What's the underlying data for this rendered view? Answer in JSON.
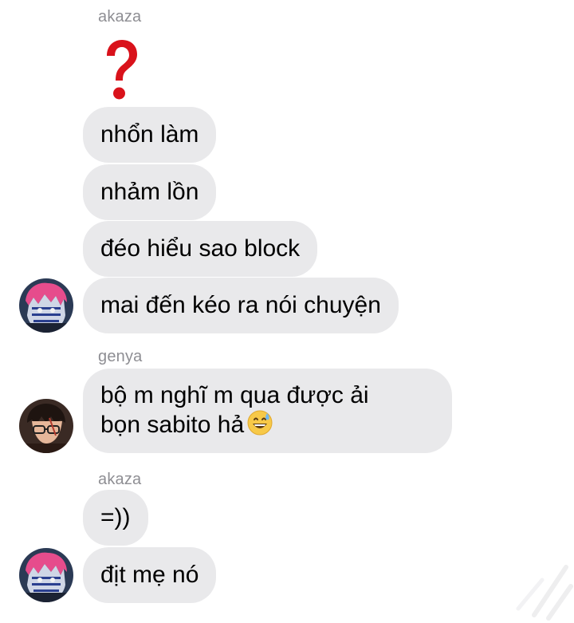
{
  "conversation": [
    {
      "sender": "akaza",
      "messages": [
        {
          "kind": "emoji",
          "icon": "red-question-mark-icon"
        },
        {
          "kind": "text",
          "text": "nhổn làm"
        },
        {
          "kind": "text",
          "text": "nhảm lồn"
        },
        {
          "kind": "text",
          "text": "đéo hiểu sao block"
        },
        {
          "kind": "text",
          "text": "mai đến kéo ra nói chuyện"
        }
      ]
    },
    {
      "sender": "genya",
      "messages": [
        {
          "kind": "text",
          "lines": [
            "bộ m nghĩ m qua được ải",
            "bọn sabito hả"
          ],
          "trailing_emoji": "grinning-face-with-sweat-icon"
        }
      ]
    },
    {
      "sender": "akaza",
      "messages": [
        {
          "kind": "text",
          "text": "=))"
        },
        {
          "kind": "text",
          "text": "địt mẹ nó"
        }
      ]
    }
  ],
  "colors": {
    "bubble_bg": "#e9e9eb",
    "sender_text": "#8e8e93",
    "question_mark": "#d9121b"
  }
}
